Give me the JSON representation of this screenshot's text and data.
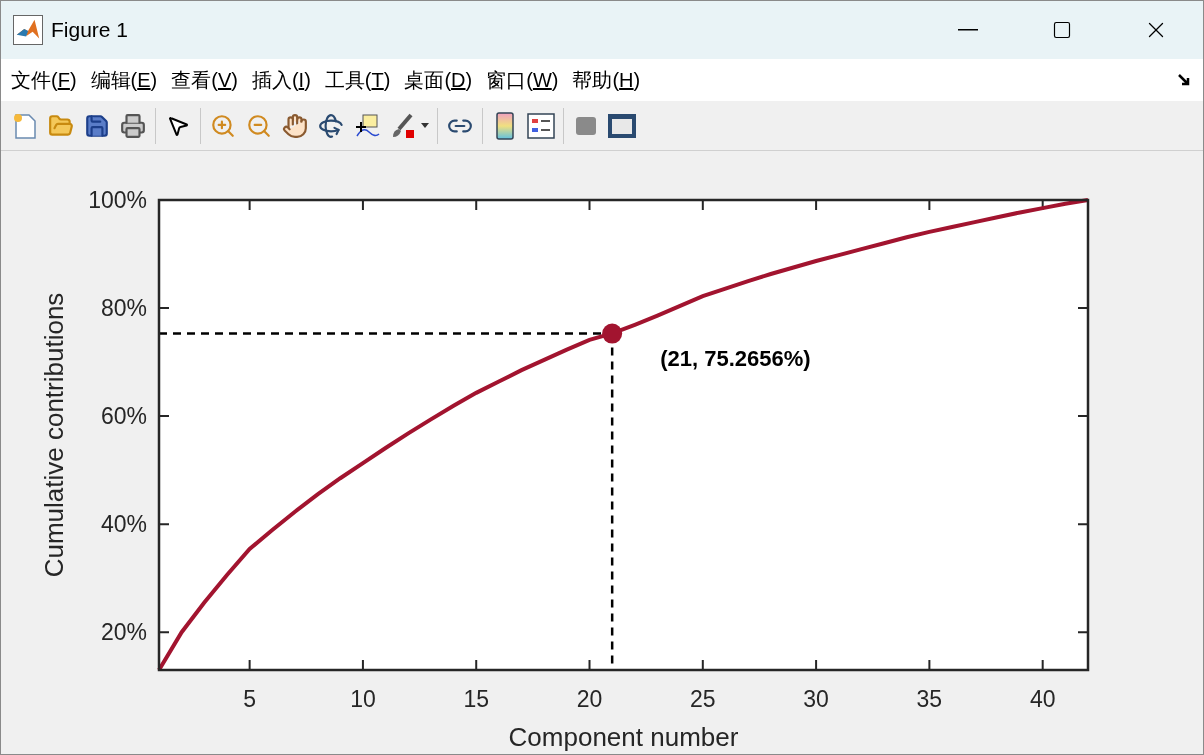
{
  "window": {
    "title": "Figure 1"
  },
  "menu": [
    {
      "label": "文件(F)"
    },
    {
      "label": "编辑(E)"
    },
    {
      "label": "查看(V)"
    },
    {
      "label": "插入(I)"
    },
    {
      "label": "工具(T)"
    },
    {
      "label": "桌面(D)"
    },
    {
      "label": "窗口(W)"
    },
    {
      "label": "帮助(H)"
    }
  ],
  "figure": {
    "chart_data": {
      "type": "line",
      "xlabel": "Component number",
      "ylabel": "Cumulative contributions",
      "x": [
        1,
        2,
        3,
        4,
        5,
        6,
        7,
        8,
        9,
        10,
        11,
        12,
        13,
        14,
        15,
        16,
        17,
        18,
        19,
        20,
        21,
        22,
        23,
        24,
        25,
        26,
        27,
        28,
        29,
        30,
        31,
        32,
        33,
        34,
        35,
        36,
        37,
        38,
        39,
        40,
        41,
        42
      ],
      "series": [
        {
          "color": "#a2142f",
          "values": [
            13.0,
            20.0,
            25.5,
            30.6,
            35.4,
            38.9,
            42.3,
            45.5,
            48.5,
            51.3,
            54.1,
            56.8,
            59.4,
            61.9,
            64.3,
            66.4,
            68.5,
            70.4,
            72.3,
            74.1,
            75.3,
            76.9,
            78.6,
            80.4,
            82.2,
            83.6,
            85.0,
            86.3,
            87.5,
            88.7,
            89.8,
            90.9,
            92.0,
            93.1,
            94.1,
            95.0,
            95.9,
            96.8,
            97.7,
            98.5,
            99.3,
            100.0
          ]
        }
      ],
      "xlim": [
        1,
        42
      ],
      "ylim": [
        13,
        100
      ],
      "xticks": [
        5,
        10,
        15,
        20,
        25,
        30,
        35,
        40
      ],
      "yticks": [
        {
          "value": 20,
          "label": "20%"
        },
        {
          "value": 40,
          "label": "40%"
        },
        {
          "value": 60,
          "label": "60%"
        },
        {
          "value": 80,
          "label": "80%"
        },
        {
          "value": 100,
          "label": "100%"
        }
      ],
      "ref_lines": [
        {
          "axis": "y",
          "value": 75.27
        },
        {
          "axis": "x",
          "value": 21
        }
      ],
      "annotations": [
        {
          "text": "(21, 75.2656%)",
          "x": 21,
          "y": 75.2656
        }
      ]
    }
  }
}
